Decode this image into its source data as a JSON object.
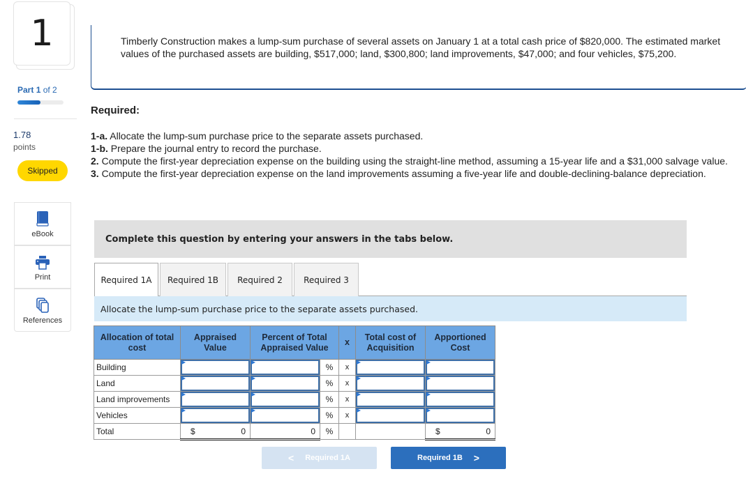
{
  "question": {
    "number": "1",
    "part_label_prefix": "Part",
    "part_current": "1",
    "part_of": "of 2",
    "progress": 0.5,
    "points_value": "1.78",
    "points_label": "points",
    "status_badge": "Skipped"
  },
  "tools": [
    {
      "label": "eBook",
      "icon": "book-icon"
    },
    {
      "label": "Print",
      "icon": "printer-icon"
    },
    {
      "label": "References",
      "icon": "copy-documents-icon"
    }
  ],
  "prompt": "Timberly Construction makes a lump-sum purchase of several assets on January 1 at a total cash price of $820,000. The estimated market values of the purchased assets are building, $517,000; land, $300,800; land improvements, $47,000; and four vehicles, $75,200.",
  "required": {
    "heading": "Required:",
    "items": [
      {
        "num": "1-a.",
        "text": " Allocate the lump-sum purchase price to the separate assets purchased."
      },
      {
        "num": "1-b.",
        "text": " Prepare the journal entry to record the purchase."
      },
      {
        "num": "2.",
        "text": " Compute the first-year depreciation expense on the building using the straight-line method, assuming a 15-year life and a $31,000 salvage value."
      },
      {
        "num": "3.",
        "text": " Compute the first-year depreciation expense on the land improvements assuming a five-year life and double-declining-balance depreciation."
      }
    ]
  },
  "instruction_banner": "Complete this question by entering your answers in the tabs below.",
  "tabs": [
    {
      "label": "Required 1A",
      "active": true
    },
    {
      "label": "Required 1B",
      "active": false
    },
    {
      "label": "Required 2",
      "active": false
    },
    {
      "label": "Required 3",
      "active": false
    }
  ],
  "tab_description": "Allocate the lump-sum purchase price to the separate assets purchased.",
  "table": {
    "headers": {
      "allocation": "Allocation of total cost",
      "appraised": "Appraised Value",
      "percent": "Percent of Total Appraised Value",
      "times": "x",
      "total_cost": "Total cost of Acquisition",
      "apportioned": "Apportioned Cost"
    },
    "rows": [
      {
        "label": "Building",
        "appraised": "",
        "percent": "",
        "pct_symbol": "%",
        "times": "x",
        "total_cost": "",
        "apportioned": ""
      },
      {
        "label": "Land",
        "appraised": "",
        "percent": "",
        "pct_symbol": "%",
        "times": "x",
        "total_cost": "",
        "apportioned": ""
      },
      {
        "label": "Land improvements",
        "appraised": "",
        "percent": "",
        "pct_symbol": "%",
        "times": "x",
        "total_cost": "",
        "apportioned": ""
      },
      {
        "label": "Vehicles",
        "appraised": "",
        "percent": "",
        "pct_symbol": "%",
        "times": "x",
        "total_cost": "",
        "apportioned": ""
      }
    ],
    "total": {
      "label": "Total",
      "appraised_currency": "$",
      "appraised_value": "0",
      "percent_value": "0",
      "pct_symbol": "%",
      "apportioned_currency": "$",
      "apportioned_value": "0"
    }
  },
  "nav": {
    "prev_label": "Required 1A",
    "next_label": "Required 1B",
    "prev_icon": "chevron-left-icon",
    "next_icon": "chevron-right-icon"
  }
}
